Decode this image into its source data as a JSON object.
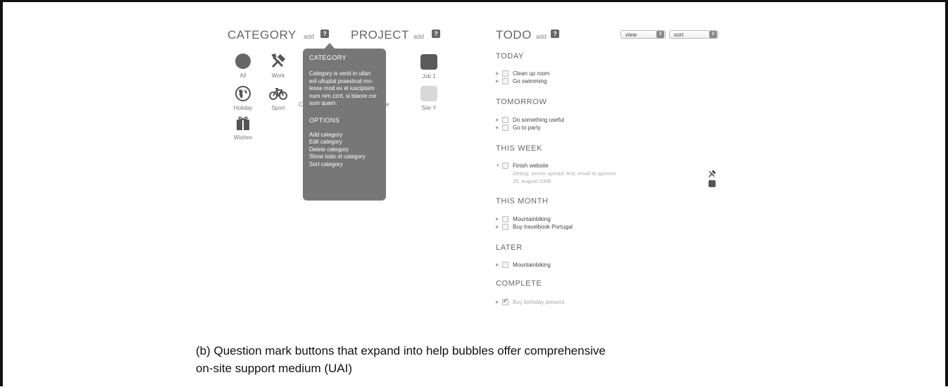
{
  "category": {
    "title": "CATEGORY",
    "add": "add",
    "help": "?"
  },
  "project": {
    "title": "PROJECT",
    "add": "add",
    "help": "?"
  },
  "todo": {
    "title": "TODO",
    "add": "add",
    "help": "?",
    "view_select": "view",
    "sort_select": "sort",
    "select_knob": "⇕"
  },
  "categories": [
    {
      "label": "All",
      "icon": "circle-icon"
    },
    {
      "label": "Work",
      "icon": "tools-icon"
    },
    {
      "label": "Holiday",
      "icon": "globe-icon"
    },
    {
      "label": "Sport",
      "icon": "bicycle-icon"
    },
    {
      "label": "Wishes",
      "icon": "gift-icon"
    }
  ],
  "hidden_fragments": {
    "c": "C",
    "e": "e"
  },
  "projects": [
    {
      "label": "Job 1",
      "color": "#5a5a5a"
    },
    {
      "label": "Site Y",
      "color": "#d8d8d8"
    }
  ],
  "bubble": {
    "title": "CATEGORY",
    "body": "Category is venit in ullan eril ulluptat praestrud mo-lesse mod ex el iuscipisim num nim zzrit, si blaore cor sum quam.",
    "options_title": "OPTIONS",
    "options": [
      "Add category",
      "Edit category",
      "Delete category",
      "Show todo of category",
      "Sort category"
    ]
  },
  "sections": {
    "today": {
      "title": "TODAY",
      "items": [
        "Clean up room",
        "Go swimming"
      ]
    },
    "tomorrow": {
      "title": "TOMORROW",
      "items": [
        "Do something useful",
        "Go to party"
      ]
    },
    "this_week": {
      "title": "THIS WEEK",
      "item": "Finish website",
      "detail": "Debug, server upload, test, email to sponsor",
      "date": "25. August 2008"
    },
    "this_month": {
      "title": "THIS MONTH",
      "items": [
        "Mountainbiking",
        "Buy travelbook Portugal"
      ]
    },
    "later": {
      "title": "LATER",
      "items": [
        "Mountainbiking"
      ]
    },
    "complete": {
      "title": "COMPLETE",
      "items": [
        "Buy birthday present"
      ]
    }
  },
  "caption": {
    "line1": "(b)  Question mark buttons that expand into help bubbles offer comprehensive",
    "line2": "on-site support medium (UAI)"
  }
}
